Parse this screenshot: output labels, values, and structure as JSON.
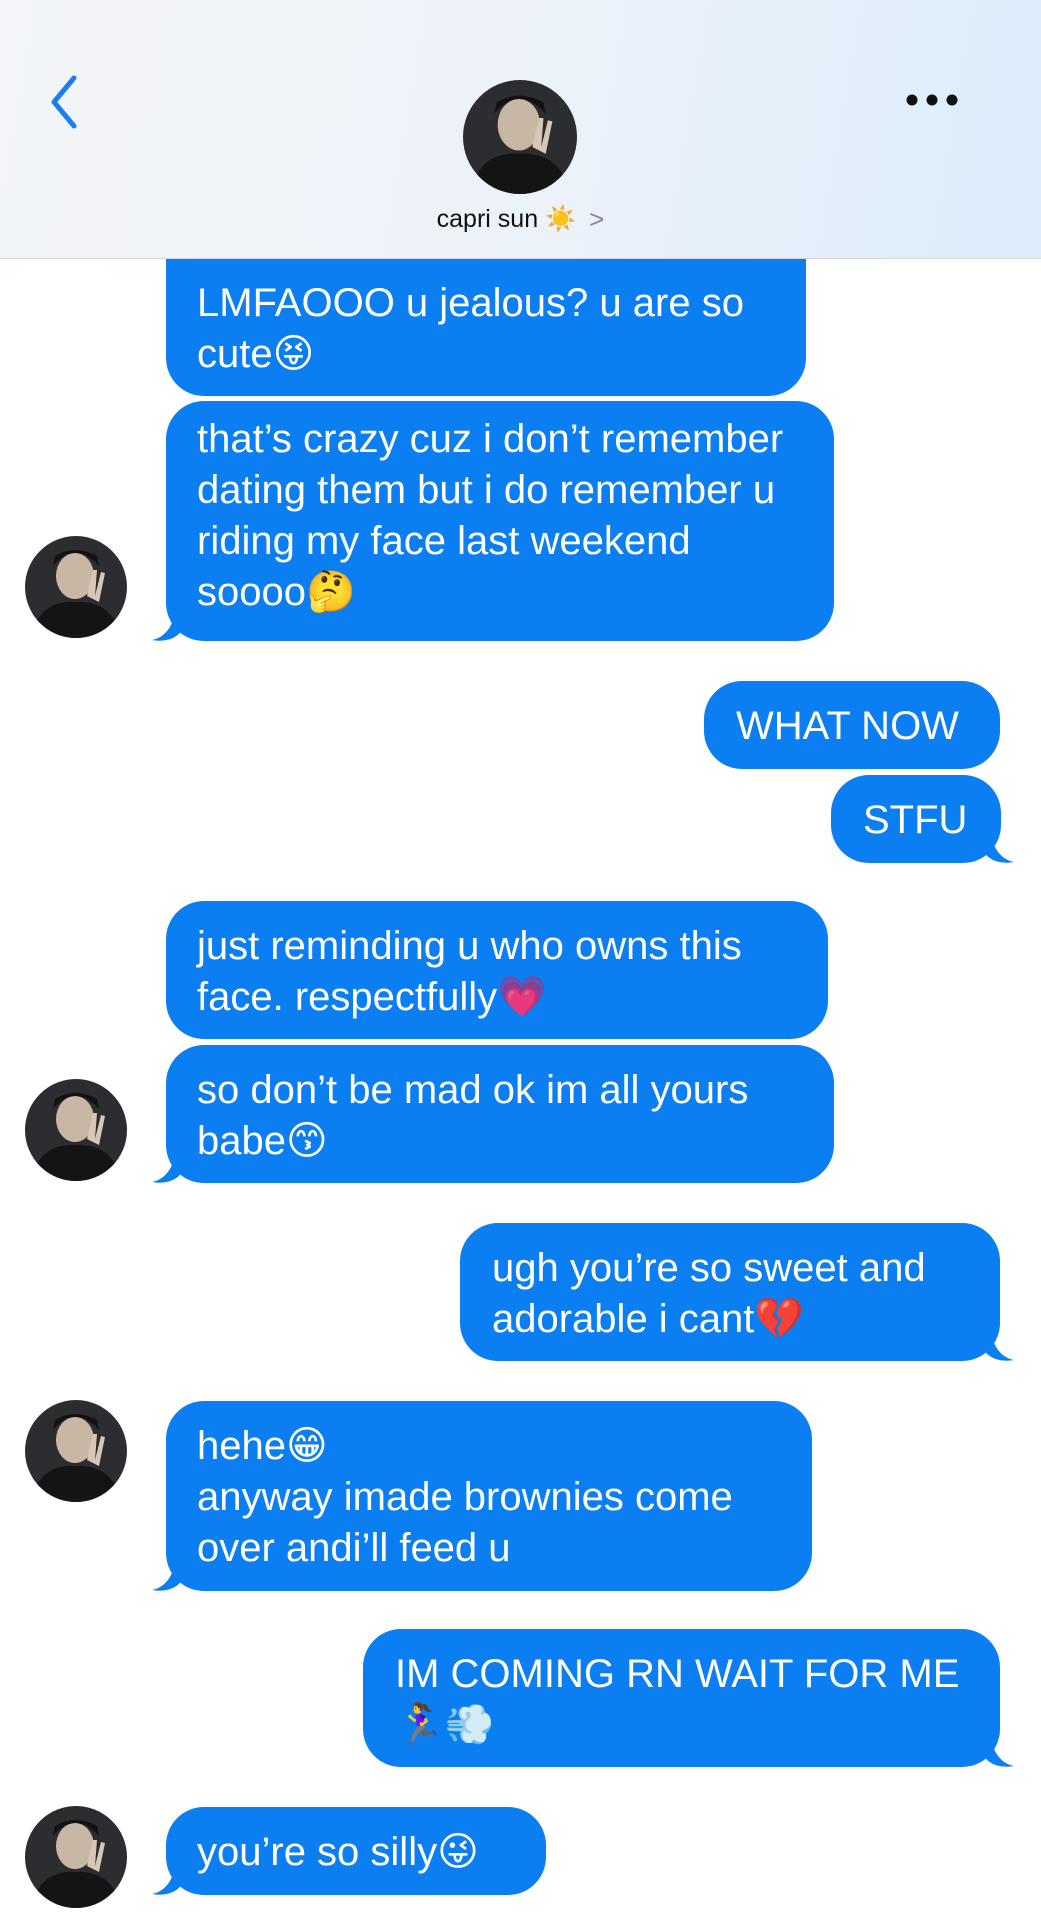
{
  "header": {
    "contact_name": "capri sun",
    "contact_emoji": "☀️",
    "chevron": ">",
    "back_icon": "chevron-left-icon",
    "more_icon": "ellipsis-icon"
  },
  "colors": {
    "bubble": "#0b7ff1",
    "accent": "#1a7ef2"
  },
  "messages": [
    {
      "side": "received",
      "text": "LMFAOOO u jealous? u are so cute😝"
    },
    {
      "side": "received",
      "text": "that’s crazy cuz i don’t remember dating them but i do remember u riding my face last weekend soooo🤔"
    },
    {
      "side": "sent",
      "text": "WHAT NOW"
    },
    {
      "side": "sent",
      "text": "STFU"
    },
    {
      "side": "received",
      "text": "just reminding u who owns this face. respectfully💗"
    },
    {
      "side": "received",
      "text": "so don’t be mad ok im all yours babe😙"
    },
    {
      "side": "sent",
      "text": "ugh you’re so sweet and adorable i cant💔"
    },
    {
      "side": "received",
      "text": "hehe😁\nanyway imade brownies come over andi’ll feed u"
    },
    {
      "side": "sent",
      "text": "IM COMING RN WAIT FOR ME 🏃‍♀️💨"
    },
    {
      "side": "received",
      "text": "you’re so silly😜"
    }
  ]
}
